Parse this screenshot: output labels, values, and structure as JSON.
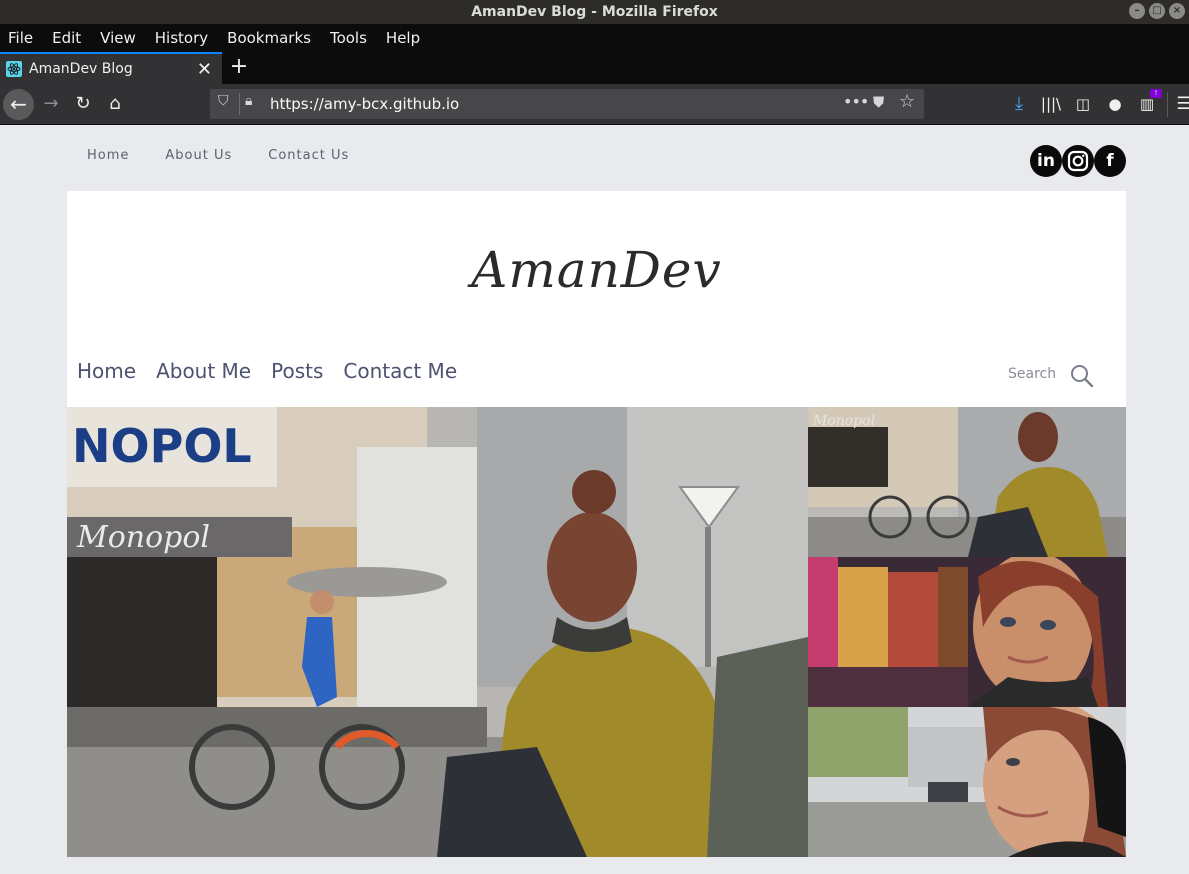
{
  "window": {
    "title": "AmanDev Blog - Mozilla Firefox"
  },
  "menubar": {
    "items": [
      "File",
      "Edit",
      "View",
      "History",
      "Bookmarks",
      "Tools",
      "Help"
    ]
  },
  "tab": {
    "title": "AmanDev Blog"
  },
  "urlbar": {
    "url": "https://amy-bcx.github.io"
  },
  "icons": {
    "back": "arrow-left-icon",
    "forward": "arrow-right-icon",
    "reload": "reload-icon",
    "home": "home-icon",
    "download": "download-icon",
    "library": "library-icon",
    "sidebar": "sidebar-icon",
    "account": "account-icon",
    "extension": "extension-icon",
    "menu": "hamburger-menu-icon"
  },
  "page": {
    "top_nav": [
      "Home",
      "About Us",
      "Contact Us"
    ],
    "social": [
      "linkedin",
      "instagram",
      "facebook"
    ],
    "logo": "AmanDev",
    "main_nav": [
      "Home",
      "About Me",
      "Posts",
      "Contact Me"
    ],
    "search_label": "Search"
  },
  "colors": {
    "accent": "#0a84ff",
    "toolbar": "#323234",
    "page_bg": "#e9eaed",
    "nav_text": "#4d5270"
  }
}
